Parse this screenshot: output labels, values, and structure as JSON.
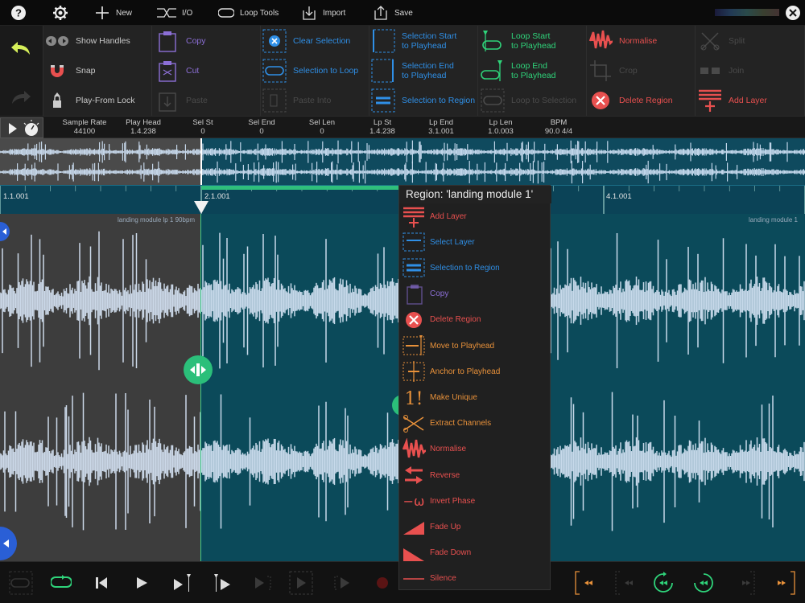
{
  "topbar": {
    "help": "?",
    "new_label": "New",
    "io_label": "I/O",
    "loop_tools_label": "Loop Tools",
    "import_label": "Import",
    "save_label": "Save"
  },
  "toolbar": {
    "show_handles": "Show Handles",
    "snap": "Snap",
    "play_from_lock": "Play-From Lock",
    "copy": "Copy",
    "cut": "Cut",
    "paste": "Paste",
    "clear_selection": "Clear Selection",
    "selection_to_loop": "Selection to Loop",
    "paste_into": "Paste Into",
    "selection_start": "Selection Start",
    "selection_start_2": "to Playhead",
    "selection_end": "Selection End",
    "selection_end_2": "to Playhead",
    "selection_to_region": "Selection to Region",
    "loop_start": "Loop Start",
    "loop_start_2": "to Playhead",
    "loop_end": "Loop End",
    "loop_end_2": "to Playhead",
    "loop_to_selection": "Loop to Selection",
    "normalise": "Normalise",
    "crop": "Crop",
    "delete_region": "Delete Region",
    "split": "Split",
    "join": "Join",
    "add_layer": "Add Layer"
  },
  "info": [
    {
      "label": "Sample Rate",
      "value": "44100"
    },
    {
      "label": "Play Head",
      "value": "1.4.238"
    },
    {
      "label": "Sel St",
      "value": "0"
    },
    {
      "label": "Sel End",
      "value": "0"
    },
    {
      "label": "Sel Len",
      "value": "0"
    },
    {
      "label": "Lp St",
      "value": "1.4.238"
    },
    {
      "label": "Lp End",
      "value": "3.1.001"
    },
    {
      "label": "Lp Len",
      "value": "1.0.003"
    },
    {
      "label": "BPM",
      "value": "90.0  4/4"
    }
  ],
  "ruler": {
    "m1": "1.1.001",
    "m2": "2.1.001",
    "m4": "4.1.001"
  },
  "regions": {
    "left_name": "landing module lp 1 90bpm",
    "right_name": "landing module 1"
  },
  "context_menu": {
    "title": "Region: 'landing module 1'",
    "items": [
      "Add Layer",
      "Select Layer",
      "Selection to Region",
      "Copy",
      "Delete Region",
      "Move to Playhead",
      "Anchor to Playhead",
      "Make Unique",
      "Extract Channels",
      "Normalise",
      "Reverse",
      "Invert Phase",
      "Fade Up",
      "Fade Down",
      "Silence"
    ]
  },
  "colors": {
    "blue": "#2f8fe6",
    "green": "#2fd37a",
    "red": "#e8504f",
    "purple": "#8c6fd6",
    "orange": "#e8913a",
    "teal_bg": "#0b4a5a"
  }
}
